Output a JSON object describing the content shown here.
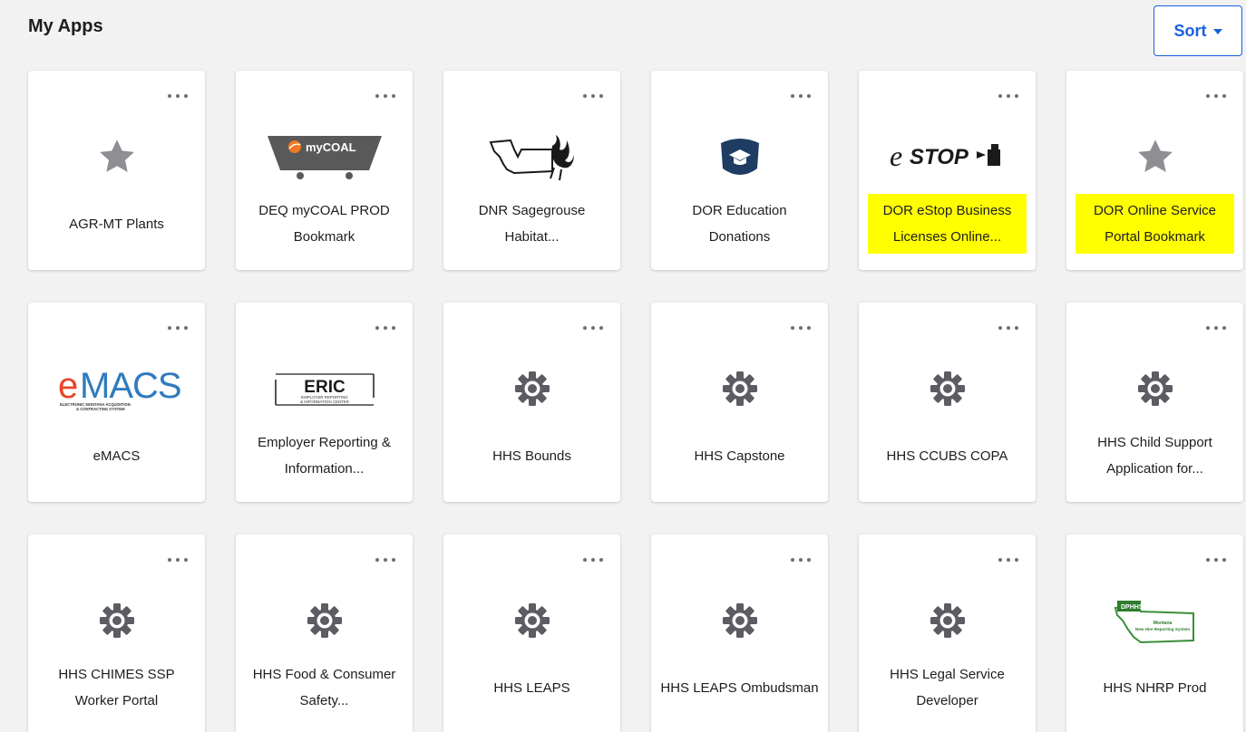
{
  "header": {
    "title": "My Apps",
    "sort_label": "Sort"
  },
  "colors": {
    "accent": "#1662dd",
    "highlight": "#ffff00",
    "icon_gray": "#6e6e78"
  },
  "tiles": [
    {
      "label": "AGR-MT Plants",
      "icon": "star-icon",
      "highlighted": false
    },
    {
      "label": "DEQ myCOAL PROD Bookmark",
      "icon": "mycoal-logo",
      "logo_text": "myCOAL",
      "highlighted": false
    },
    {
      "label": "DNR Sagegrouse Habitat...",
      "icon": "montana-sagegrouse-logo",
      "highlighted": false
    },
    {
      "label": "DOR Education Donations",
      "icon": "graduation-cap-icon",
      "highlighted": false
    },
    {
      "label": "DOR eStop Business Licenses Online...",
      "icon": "estop-logo",
      "logo_text": "eSTOP",
      "highlighted": true
    },
    {
      "label": "DOR Online Service Portal Bookmark",
      "icon": "star-icon",
      "highlighted": true
    },
    {
      "label": "eMACS",
      "icon": "emacs-logo",
      "logo_text": "eMACS",
      "logo_subtext": "ELECTRONIC MONTANA ACQUISITION & CONTRACTING SYSTEM",
      "highlighted": false
    },
    {
      "label": "Employer Reporting & Information...",
      "icon": "eric-logo",
      "logo_text": "ERIC",
      "logo_subtext": "EMPLOYER REPORTING & INFORMATION CENTER",
      "highlighted": false
    },
    {
      "label": "HHS Bounds",
      "icon": "gear-icon",
      "highlighted": false
    },
    {
      "label": "HHS Capstone",
      "icon": "gear-icon",
      "highlighted": false
    },
    {
      "label": "HHS CCUBS COPA",
      "icon": "gear-icon",
      "highlighted": false
    },
    {
      "label": "HHS Child Support Application for...",
      "icon": "gear-icon",
      "highlighted": false
    },
    {
      "label": "HHS CHIMES SSP Worker Portal",
      "icon": "gear-icon",
      "highlighted": false
    },
    {
      "label": "HHS Food & Consumer Safety...",
      "icon": "gear-icon",
      "highlighted": false
    },
    {
      "label": "HHS LEAPS",
      "icon": "gear-icon",
      "highlighted": false
    },
    {
      "label": "HHS LEAPS Ombudsman",
      "icon": "gear-icon",
      "highlighted": false
    },
    {
      "label": "HHS Legal Service Developer",
      "icon": "gear-icon",
      "highlighted": false
    },
    {
      "label": "HHS NHRP Prod",
      "icon": "nhrp-logo",
      "logo_text": "DPHHS",
      "logo_subtext": "Montana New Hire Reporting System",
      "highlighted": false
    }
  ]
}
